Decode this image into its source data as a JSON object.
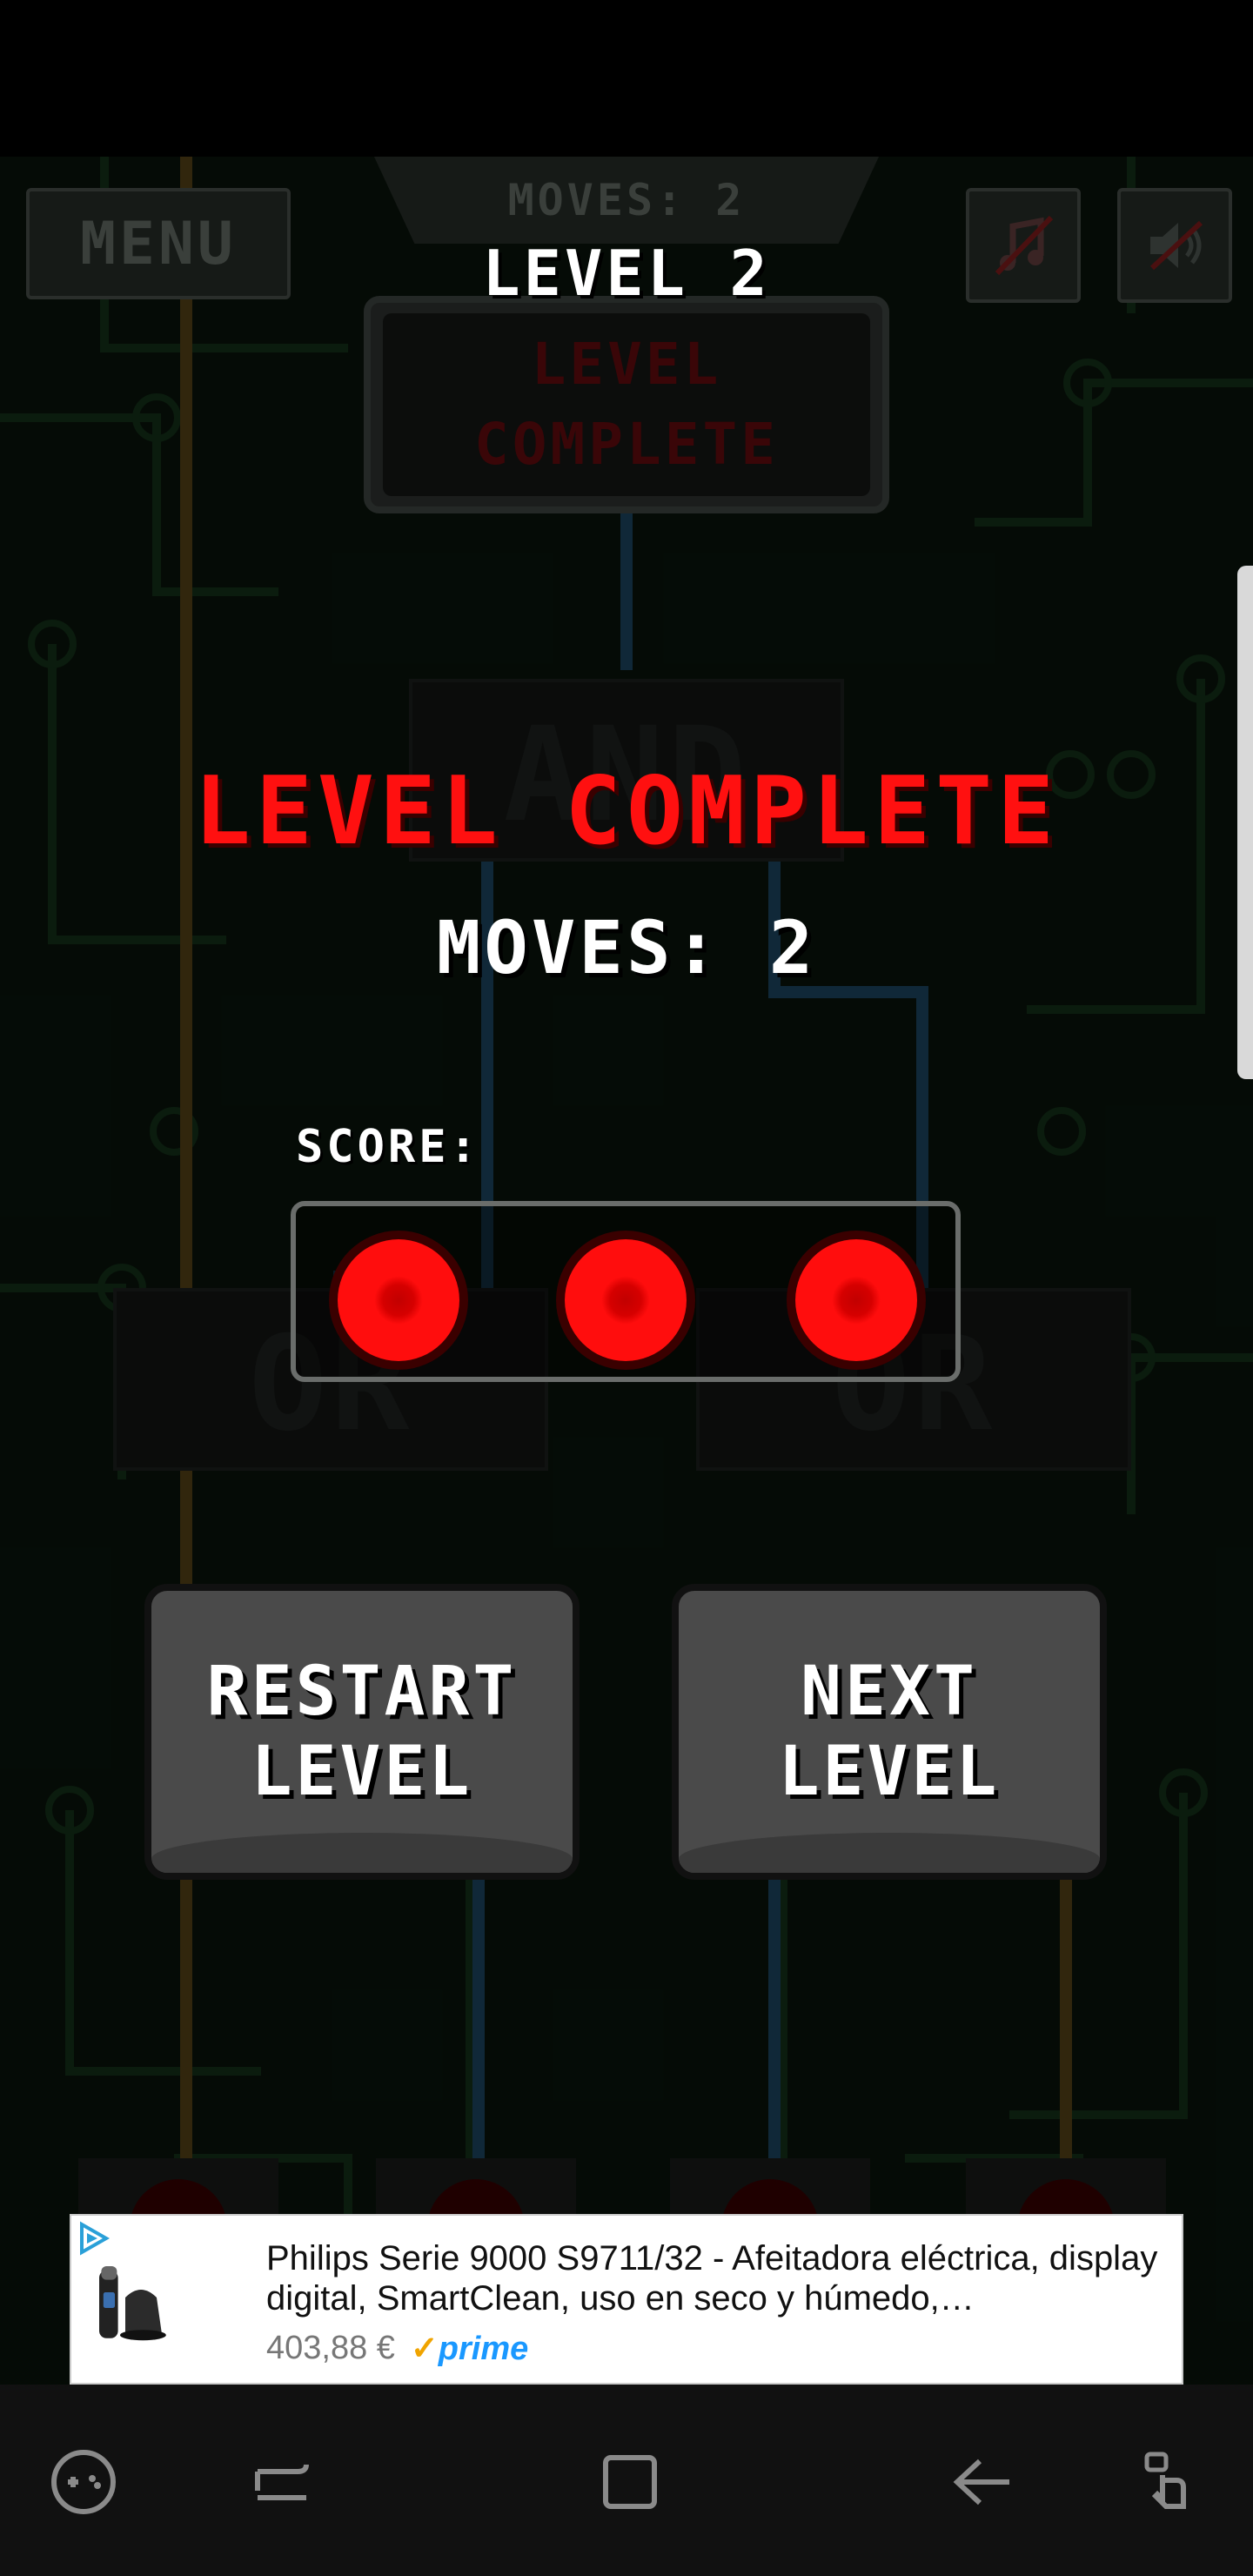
{
  "hud": {
    "menu_label": "MENU",
    "moves_counter": "MOVES: 2",
    "level_title": "LEVEL 2",
    "sign_line1": "LEVEL",
    "sign_line2": "COMPLETE",
    "chip_top_label": "AND",
    "chip_left_label": "OR",
    "chip_right_label": "OR"
  },
  "result": {
    "headline": "LEVEL COMPLETE",
    "moves": "MOVES: 2",
    "score_label": "SCORE:",
    "score_stars": 3
  },
  "buttons": {
    "restart": "RESTART\nLEVEL",
    "next": "NEXT\nLEVEL"
  },
  "ad": {
    "title": "Philips Serie 9000 S9711/32 - Afeitadora eléctrica, display digital, SmartClean, uso en seco y húmedo,…",
    "price": "403,88 €",
    "prime": "prime"
  },
  "colors": {
    "accent_red": "#ff1010",
    "board_green": "#0a150c",
    "button_grey": "#4a4a4a"
  },
  "nav": {
    "icons": [
      "game-tools-icon",
      "recent-apps-icon",
      "home-icon",
      "back-icon",
      "touch-lock-icon"
    ]
  }
}
